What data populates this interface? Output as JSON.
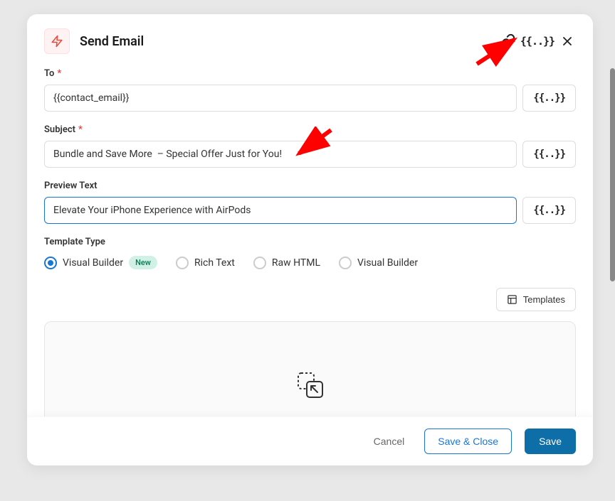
{
  "modal": {
    "title": "Send Email"
  },
  "fields": {
    "to": {
      "label": "To",
      "value": "{{contact_email}}",
      "required": true
    },
    "subject": {
      "label": "Subject",
      "value": "Bundle and Save More  – Special Offer Just for You!",
      "required": true
    },
    "preview_text": {
      "label": "Preview Text",
      "value": "Elevate Your iPhone Experience with AirPods",
      "required": false
    }
  },
  "template_type": {
    "label": "Template Type",
    "options": [
      {
        "label": "Visual Builder",
        "selected": true,
        "badge": "New"
      },
      {
        "label": "Rich Text",
        "selected": false
      },
      {
        "label": "Raw HTML",
        "selected": false
      },
      {
        "label": "Visual Builder",
        "selected": false
      }
    ]
  },
  "buttons": {
    "templates": "Templates",
    "cancel": "Cancel",
    "save_close": "Save & Close",
    "save": "Save"
  },
  "vars_glyph": "{{..}}"
}
